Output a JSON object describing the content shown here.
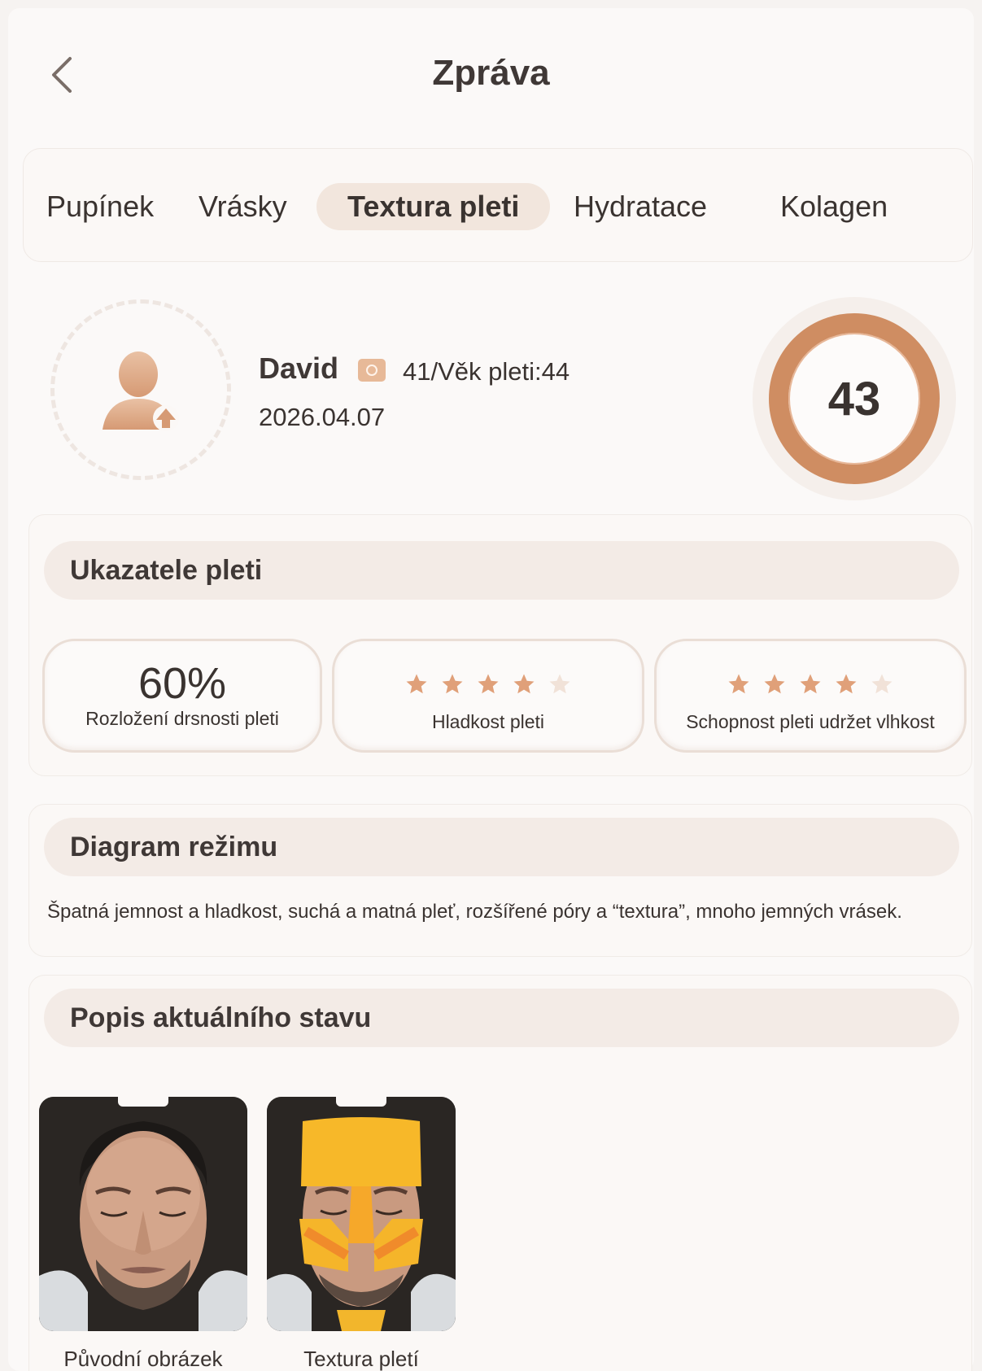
{
  "header": {
    "title": "Zpráva"
  },
  "tabs": [
    {
      "label": "Pupínek"
    },
    {
      "label": "Vrásky"
    },
    {
      "label": "Textura pleti"
    },
    {
      "label": "Hydratace"
    },
    {
      "label": "Kolagen"
    }
  ],
  "active_tab": "Textura pleti",
  "profile": {
    "name": "David",
    "age_text": "41/Věk pleti:44",
    "date": "2026.04.07",
    "score": "43"
  },
  "indicators": {
    "title": "Ukazatele pleti",
    "items": [
      {
        "value": "60%",
        "label": "Rozložení drsnosti pleti"
      },
      {
        "label": "Hladkost pleti",
        "stars": 4,
        "max_stars": 5
      },
      {
        "label": "Schopnost pleti udržet vlhkost",
        "stars": 4,
        "max_stars": 5
      }
    ]
  },
  "mode": {
    "title": "Diagram režimu",
    "text": "Špatná jemnost a hladkost, suchá a matná pleť, rozšířené póry a “textura”, mnoho jemných vrásek."
  },
  "status": {
    "title": "Popis aktuálního stavu",
    "photos": [
      {
        "caption": "Původní obrázek"
      },
      {
        "caption": "Textura pletí"
      }
    ]
  },
  "colors": {
    "accent": "#cf8d62",
    "star_filled": "#e0a079",
    "star_empty": "#f1e2d8",
    "texture_overlay": "#f5b52a"
  },
  "icons": [
    "chevron-left-icon",
    "user-upload-icon",
    "camera-icon",
    "star-icon"
  ]
}
